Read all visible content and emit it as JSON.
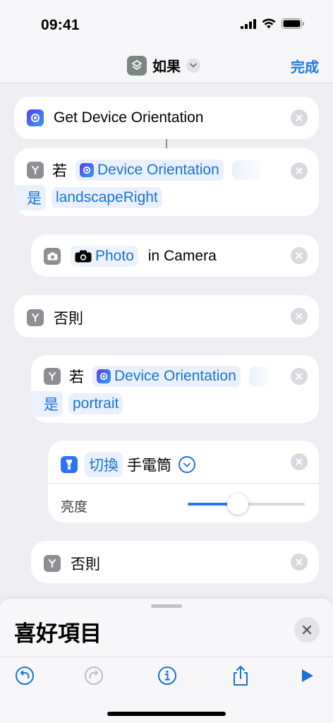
{
  "status_bar": {
    "time": "09:41"
  },
  "nav": {
    "title": "如果",
    "done_label": "完成"
  },
  "actions": {
    "get_orientation": {
      "label": "Get Device Orientation"
    },
    "if1": {
      "keyword": "若",
      "variable": "Device Orientation",
      "operator": "是",
      "value": "landscapeRight"
    },
    "photo": {
      "variable": "Photo",
      "suffix": "in Camera"
    },
    "otherwise1": {
      "label": "否則"
    },
    "if2": {
      "keyword": "若",
      "variable": "Device Orientation",
      "operator": "是",
      "value": "portrait"
    },
    "flashlight": {
      "verb": "切換",
      "object": "手電筒",
      "brightness_label": "亮度",
      "brightness_value": 0.43
    },
    "otherwise2": {
      "label": "否則"
    }
  },
  "sheet": {
    "title": "喜好項目"
  },
  "colors": {
    "accent": "#1a72d8",
    "card": "#ffffff",
    "background": "#eeeef3"
  }
}
